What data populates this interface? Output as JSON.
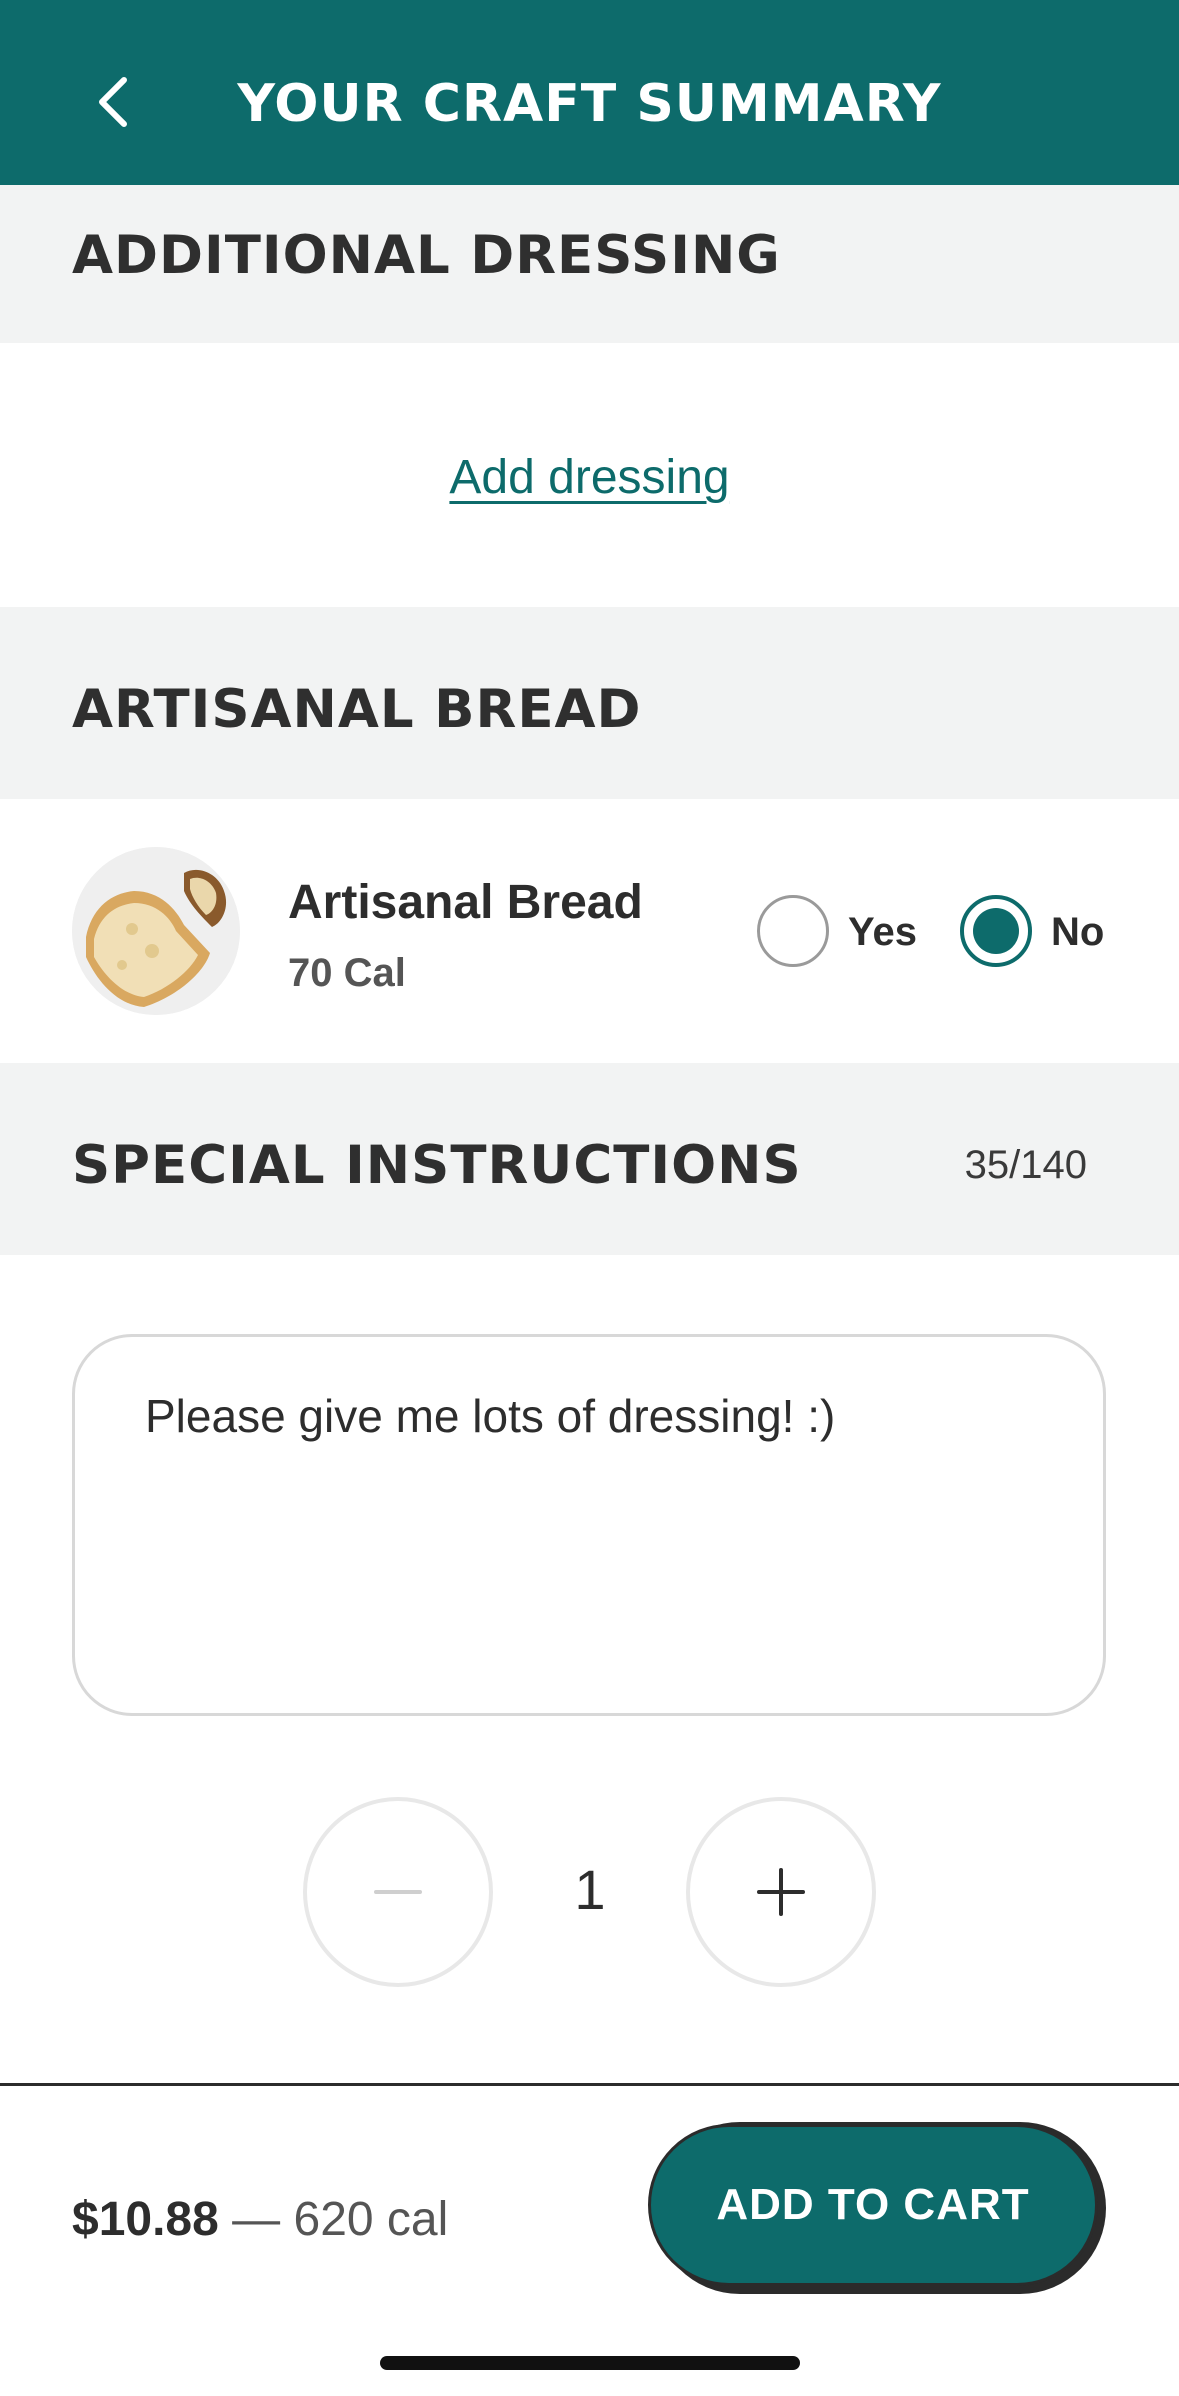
{
  "header": {
    "title": "YOUR CRAFT SUMMARY",
    "back_icon": "chevron-left-icon"
  },
  "dressing": {
    "section_title": "ADDITIONAL DRESSING",
    "add_link": "Add dressing"
  },
  "bread": {
    "section_title": "ARTISANAL BREAD",
    "item_name": "Artisanal Bread",
    "calories": "70 Cal",
    "option_yes": "Yes",
    "option_no": "No",
    "selected": "No"
  },
  "instructions": {
    "section_title": "SPECIAL INSTRUCTIONS",
    "char_count": "35/140",
    "text": "Please give me lots of dressing! :)"
  },
  "quantity": {
    "value": "1",
    "minus_icon": "minus-icon",
    "plus_icon": "plus-icon"
  },
  "footer": {
    "price": "$10.88",
    "separator": "—",
    "calories": "620 cal",
    "add_to_cart": "ADD TO CART"
  },
  "colors": {
    "brand": "#0d6b6b",
    "section_bg": "#f2f3f3",
    "text": "#2d2d2d"
  }
}
